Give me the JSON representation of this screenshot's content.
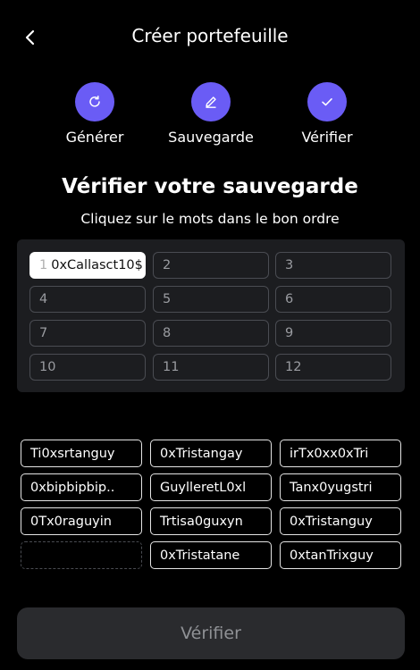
{
  "header": {
    "title": "Créer portefeuille",
    "back_icon": "chevron-left-icon"
  },
  "steps": [
    {
      "label": "Générer",
      "icon": "refresh-icon"
    },
    {
      "label": "Sauvegarde",
      "icon": "pencil-icon"
    },
    {
      "label": "Vérifier",
      "icon": "check-icon"
    }
  ],
  "accent_color": "#6a5cf5",
  "verify": {
    "title": "Vérifier votre sauvegarde",
    "subtitle": "Cliquez sur le mots dans le bon ordre"
  },
  "slots": [
    {
      "num": "1",
      "word": "0xCallasct10$"
    },
    {
      "num": "2",
      "word": ""
    },
    {
      "num": "3",
      "word": ""
    },
    {
      "num": "4",
      "word": ""
    },
    {
      "num": "5",
      "word": ""
    },
    {
      "num": "6",
      "word": ""
    },
    {
      "num": "7",
      "word": ""
    },
    {
      "num": "8",
      "word": ""
    },
    {
      "num": "9",
      "word": ""
    },
    {
      "num": "10",
      "word": ""
    },
    {
      "num": "11",
      "word": ""
    },
    {
      "num": "12",
      "word": ""
    }
  ],
  "words": [
    "Ti0xsrtanguy",
    "0xTristangay",
    "irTx0xx0xTri",
    "0xbipbipbip..",
    "GuylleretL0xl",
    "Tanx0yugstri",
    "0Tx0raguyin",
    "Trtisa0guxyn",
    "0xTristanguy",
    "",
    "0xTristatane",
    "0xtanTrixguy"
  ],
  "button": {
    "label": "Vérifier"
  }
}
